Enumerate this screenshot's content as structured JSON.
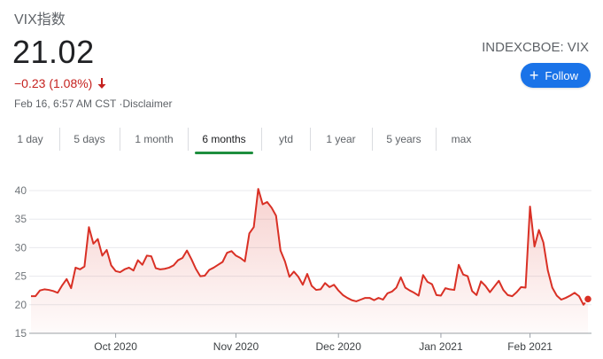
{
  "header": {
    "title": "VIX指数",
    "price": "21.02",
    "change": "−0.23 (1.08%)",
    "timestamp": "Feb 16, 6:57 AM CST ·",
    "disclaimer": "Disclaimer",
    "exchange": "INDEXCBOE: VIX",
    "follow_label": "Follow",
    "down_color": "#c5221f"
  },
  "tabs": [
    {
      "label": "1 day"
    },
    {
      "label": "5 days"
    },
    {
      "label": "1 month"
    },
    {
      "label": "6 months",
      "active": true
    },
    {
      "label": "ytd"
    },
    {
      "label": "1 year"
    },
    {
      "label": "5 years"
    },
    {
      "label": "max"
    }
  ],
  "chart_data": {
    "type": "area",
    "title": "",
    "xlabel": "",
    "ylabel": "",
    "ylim": [
      15,
      40
    ],
    "yticks": [
      15,
      20,
      25,
      30,
      35,
      40
    ],
    "grid": true,
    "line_color": "#d93025",
    "x_tick_labels": [
      "Oct 2020",
      "Nov 2020",
      "Dec 2020",
      "Jan 2021",
      "Feb 2021"
    ],
    "x_tick_index": [
      19,
      46,
      69,
      92,
      112
    ],
    "values": [
      21.5,
      21.5,
      22.5,
      22.7,
      22.6,
      22.4,
      22.1,
      23.4,
      24.5,
      22.9,
      26.5,
      26.2,
      26.7,
      33.6,
      30.7,
      31.5,
      28.6,
      29.6,
      26.9,
      25.9,
      25.7,
      26.2,
      26.5,
      26.0,
      27.8,
      27.0,
      28.6,
      28.5,
      26.4,
      26.2,
      26.3,
      26.5,
      26.9,
      27.8,
      28.2,
      29.5,
      28.0,
      26.3,
      25.0,
      25.1,
      26.1,
      26.5,
      27.0,
      27.5,
      29.1,
      29.4,
      28.6,
      28.2,
      27.6,
      32.5,
      33.6,
      40.3,
      37.6,
      38.0,
      37.0,
      35.6,
      29.5,
      27.6,
      24.9,
      25.8,
      24.9,
      23.5,
      25.4,
      23.3,
      22.6,
      22.7,
      23.8,
      23.1,
      23.5,
      22.5,
      21.7,
      21.2,
      20.8,
      20.6,
      20.9,
      21.2,
      21.2,
      20.8,
      21.2,
      20.9,
      22.0,
      22.3,
      23.0,
      24.8,
      23.0,
      22.5,
      22.1,
      21.6,
      25.2,
      24.0,
      23.6,
      21.7,
      21.6,
      22.9,
      22.7,
      22.6,
      27.0,
      25.3,
      25.0,
      22.4,
      21.7,
      24.1,
      23.3,
      22.2,
      23.2,
      24.2,
      22.6,
      21.7,
      21.5,
      22.2,
      23.1,
      23.0,
      37.2,
      30.2,
      33.1,
      30.9,
      26.0,
      23.0,
      21.6,
      20.9,
      21.2,
      21.6,
      22.1,
      21.5,
      20.0,
      21.0
    ]
  }
}
